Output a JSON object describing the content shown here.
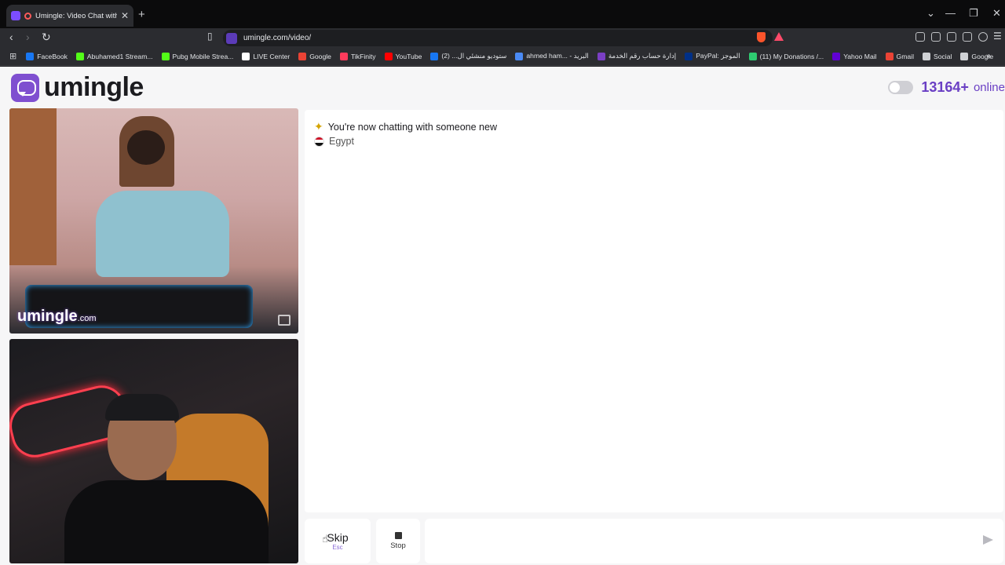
{
  "browser": {
    "tab_title": "Umingle: Video Chat with Stra",
    "url": "umingle.com/video/",
    "bookmarks": [
      {
        "label": "FaceBook",
        "color": "#1877f2"
      },
      {
        "label": "Abuhamed1 Stream...",
        "color": "#53fc18"
      },
      {
        "label": "Pubg Mobile Strea...",
        "color": "#53fc18"
      },
      {
        "label": "LIVE Center",
        "color": "#ffffff"
      },
      {
        "label": "Google",
        "color": "#ea4335"
      },
      {
        "label": "TikFinity",
        "color": "#ff3b5c"
      },
      {
        "label": "YouTube",
        "color": "#ff0000"
      },
      {
        "label": "ستوديو منشئي ال... (2)",
        "color": "#1877f2"
      },
      {
        "label": "ahmed ham... - البريد",
        "color": "#4a8af4"
      },
      {
        "label": "إدارة حساب رقم الخدمة",
        "color": "#7b3fc4"
      },
      {
        "label": "PayPal: الموجز",
        "color": "#003087"
      },
      {
        "label": "(11) My Donations /...",
        "color": "#2ecc71"
      },
      {
        "label": "Yahoo Mail",
        "color": "#6001d2"
      },
      {
        "label": "Gmail",
        "color": "#ea4335"
      },
      {
        "label": "Social",
        "color": "#cfd1d4"
      },
      {
        "label": "Google",
        "color": "#cfd1d4"
      }
    ]
  },
  "site": {
    "logo_text": "umingle",
    "online_count": "13164+",
    "online_label": "online",
    "brand_color": "#7f4fd0"
  },
  "video": {
    "watermark": "umingle",
    "watermark_suffix": ".com"
  },
  "chat": {
    "system_message": "You're now chatting with someone new",
    "country": "Egypt"
  },
  "controls": {
    "skip_label": "Skip",
    "skip_hint": "Esc",
    "stop_label": "Stop",
    "input_placeholder": ""
  }
}
